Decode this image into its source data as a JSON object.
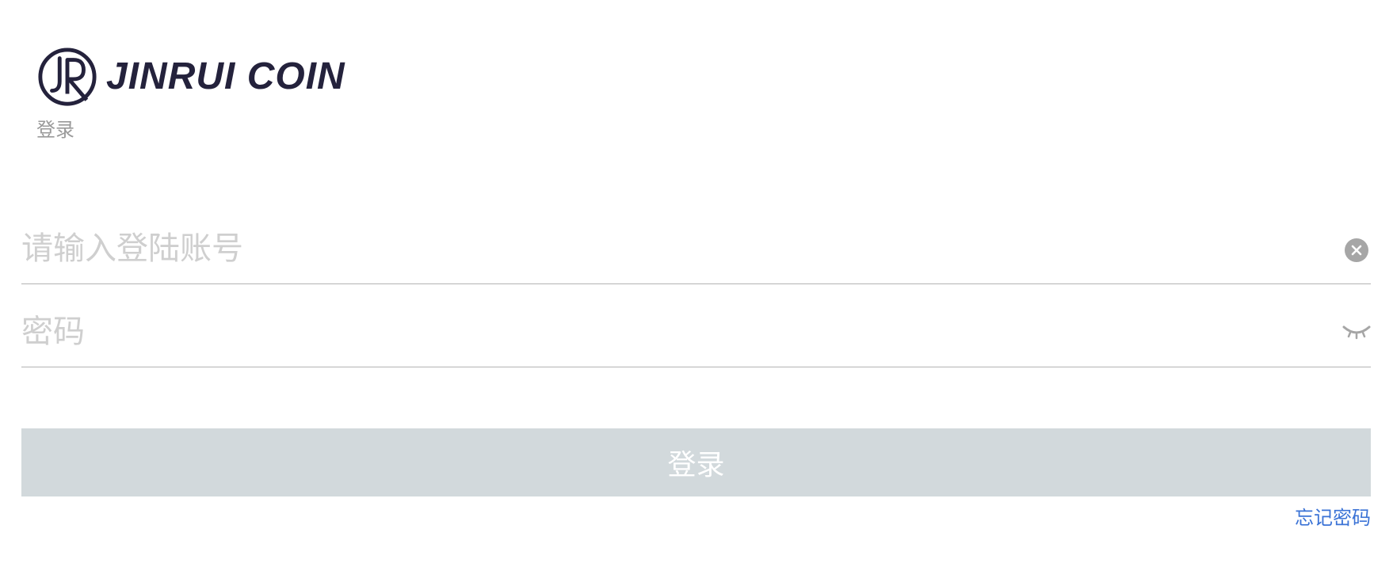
{
  "brand": {
    "name": "JINRUI COIN",
    "color": "#24223c",
    "logo_icon": "jr-monogram-icon"
  },
  "page": {
    "subtitle": "登录"
  },
  "form": {
    "account": {
      "placeholder": "请输入登陆账号",
      "value": "",
      "clear_icon": "clear-circle-icon"
    },
    "password": {
      "placeholder": "密码",
      "value": "",
      "visibility_icon": "eye-closed-icon"
    },
    "submit_label": "登录",
    "forgot_label": "忘记密码"
  },
  "colors": {
    "button_bg": "#d2d9dc",
    "link": "#3b73d6",
    "placeholder": "#cfcfcf",
    "subtitle": "#9a9a9a"
  }
}
